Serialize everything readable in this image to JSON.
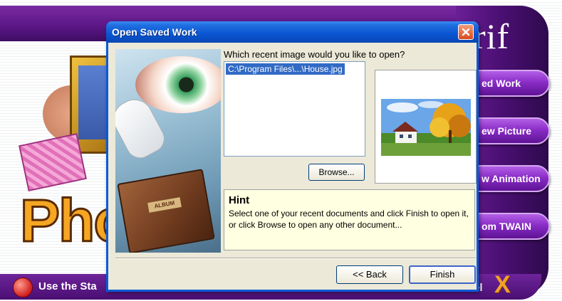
{
  "background_app": {
    "logo_text": "rif",
    "side_buttons": [
      "ed Work",
      "ew Picture",
      "w Animation",
      "om TWAIN"
    ],
    "photo_text": "Pho",
    "start_text": "Use the Sta",
    "cancel_text": "el",
    "cancel_icon": "X"
  },
  "dialog": {
    "title": "Open Saved Work",
    "close_icon": "close-icon",
    "prompt": "Which recent image would you like to open?",
    "recent_files": [
      "C:\\Program Files\\...\\House.jpg"
    ],
    "browse_label": "Browse...",
    "hint_title": "Hint",
    "hint_text": "Select one of your recent documents and click Finish to open it, or click Browse to open any other document...",
    "back_label": "<< Back",
    "finish_label": "Finish",
    "album_label": "ALBUM"
  },
  "colors": {
    "title_bar": "#0a55d2",
    "selection": "#316ac5",
    "hint_bg": "#ffffe1",
    "app_purple": "#5a1685",
    "accent_orange": "#f5a623"
  }
}
